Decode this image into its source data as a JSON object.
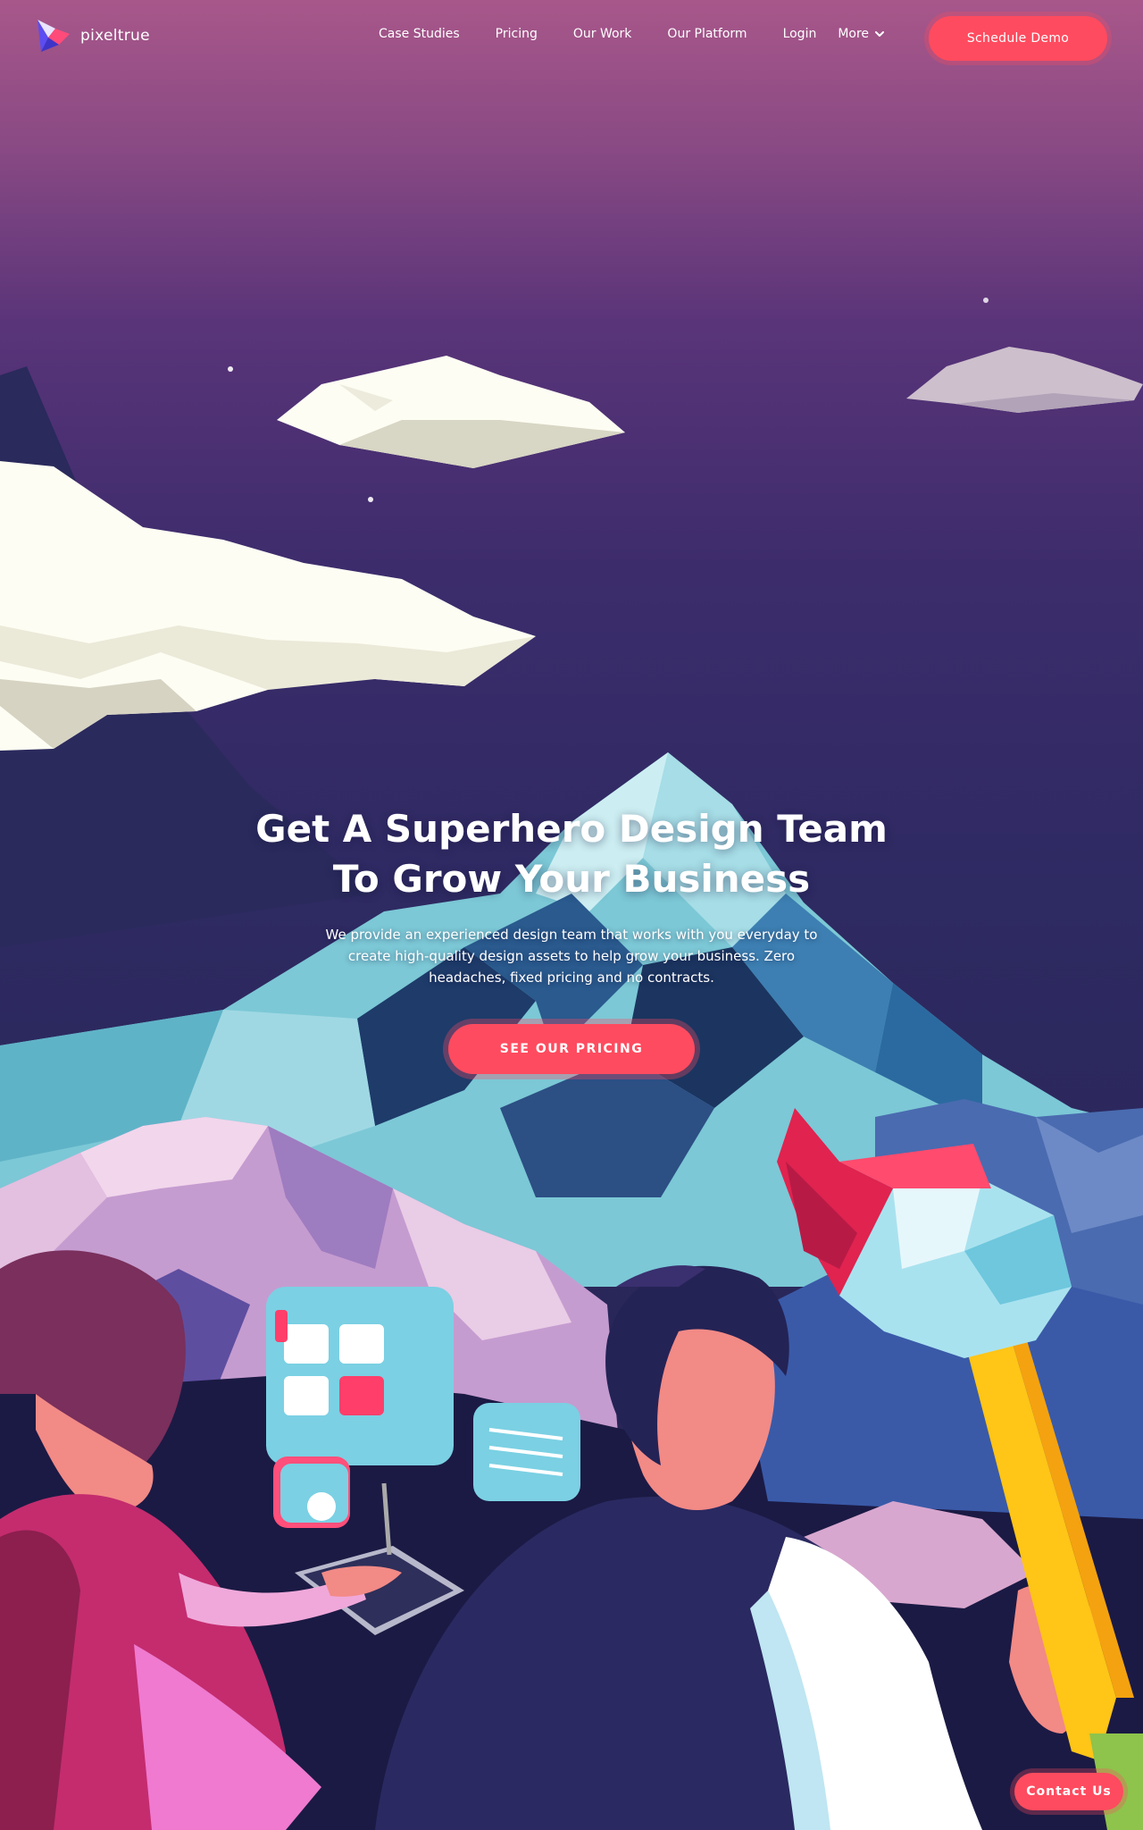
{
  "header": {
    "logo_text": "pixeltrue",
    "nav": [
      {
        "label": "Case Studies"
      },
      {
        "label": "Pricing"
      },
      {
        "label": "Our Work"
      },
      {
        "label": "Our Platform"
      },
      {
        "label": "Login"
      },
      {
        "label": "More"
      }
    ],
    "cta_label": "Schedule Demo"
  },
  "hero": {
    "title_line1": "Get A Superhero Design Team",
    "title_line2": "To Grow Your Business",
    "subtitle": "We provide an experienced design team that works with you everyday to create high-quality design assets to help grow your business. Zero headaches, fixed pricing and no contracts.",
    "cta_label": "SEE OUR PRICING"
  },
  "contact": {
    "label": "Contact Us"
  },
  "icons": {
    "logo": "pixeltrue-logo-icon",
    "more_dropdown": "chevron-down-icon"
  },
  "colors": {
    "accent": "#ff4b5f",
    "sky_top": "#a8578a",
    "sky_bottom": "#2e2a62",
    "text": "#ffffff"
  }
}
